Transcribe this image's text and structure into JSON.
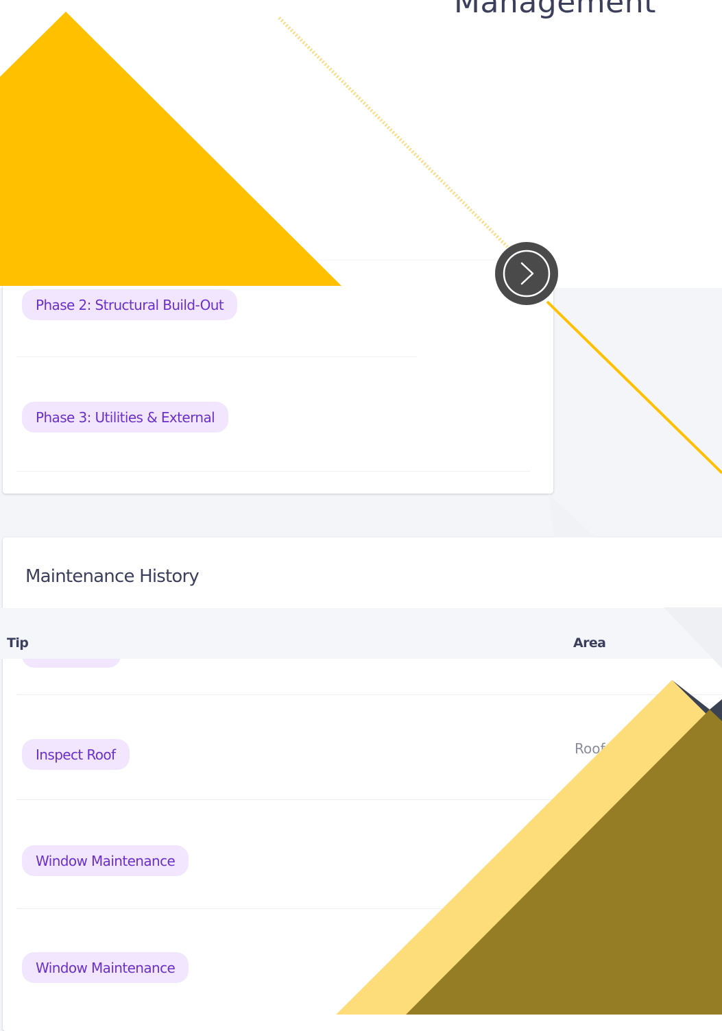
{
  "header": {
    "title": "Management"
  },
  "phases": {
    "items": [
      {
        "label": "Phase 2: Structural Build-Out"
      },
      {
        "label": "Phase 3: Utilities & External"
      }
    ]
  },
  "maintenance_history": {
    "title": "Maintenance History",
    "columns": [
      "Tip",
      "Area"
    ],
    "rows": [
      {
        "tip": "",
        "area": ""
      },
      {
        "tip": "Inspect Roof",
        "area": "Roof"
      },
      {
        "tip": "Window Maintenance",
        "area": ""
      },
      {
        "tip": "Window Maintenance",
        "area": ""
      }
    ]
  },
  "navigation": {
    "next_icon": "chevron-right-icon"
  },
  "colors": {
    "accent_yellow": "#FFC000",
    "light_yellow": "#FDDC7A",
    "olive": "#957D26",
    "dark_slate": "#3B4353",
    "pill_bg": "#F1E6FD",
    "pill_text": "#6A31C9",
    "nav_button": "#4A4A4A"
  }
}
